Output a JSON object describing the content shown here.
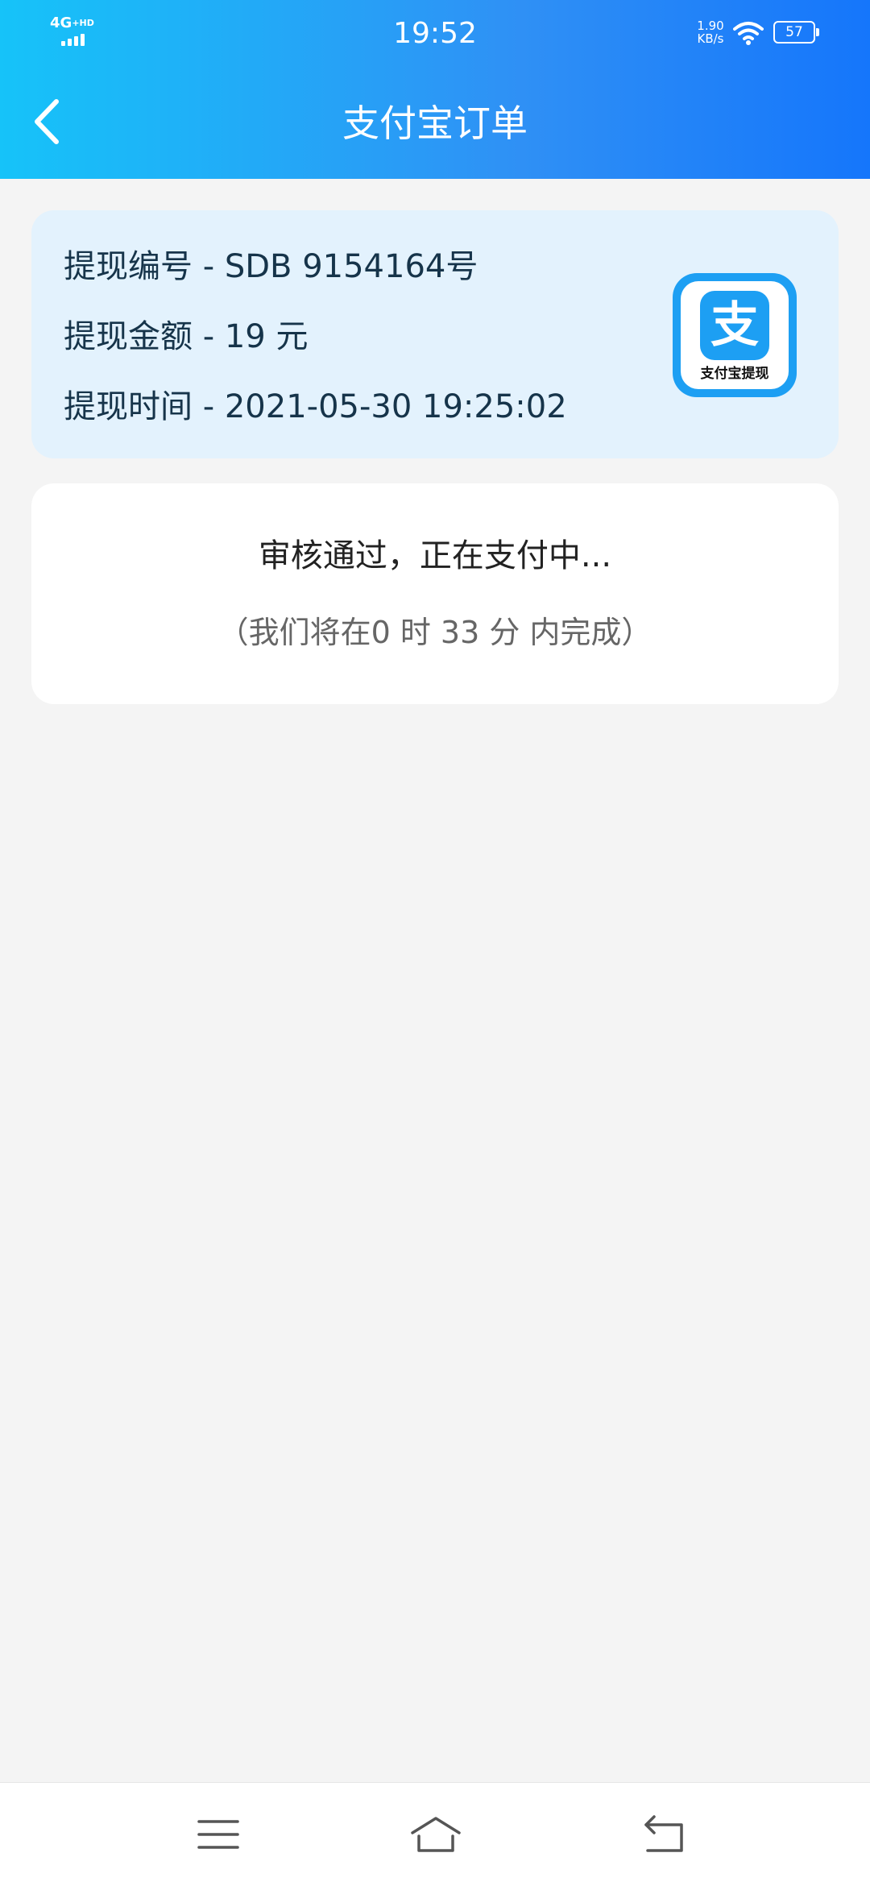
{
  "status_bar": {
    "network": "4G",
    "network_badge": "+HD",
    "time": "19:52",
    "speed_value": "1.90",
    "speed_unit": "KB/s",
    "battery": "57"
  },
  "header": {
    "title": "支付宝订单"
  },
  "order": {
    "number_line": "提现编号 - SDB 9154164号",
    "amount_line": "提现金额 - 19 元",
    "time_line": "提现时间 - 2021-05-30 19:25:02",
    "badge_glyph": "支",
    "badge_caption": "支付宝提现"
  },
  "status": {
    "main": "审核通过，正在支付中...",
    "sub": "（我们将在0 时 33 分 内完成）"
  },
  "colors": {
    "header_start": "#16c3f9",
    "header_end": "#1576fb",
    "info_card": "#e3f2fd",
    "alipay_blue": "#1d9ff3"
  },
  "icons": {
    "back": "chevron-left-icon",
    "menu": "menu-icon",
    "home": "home-icon",
    "return": "return-icon",
    "wifi": "wifi-icon"
  }
}
